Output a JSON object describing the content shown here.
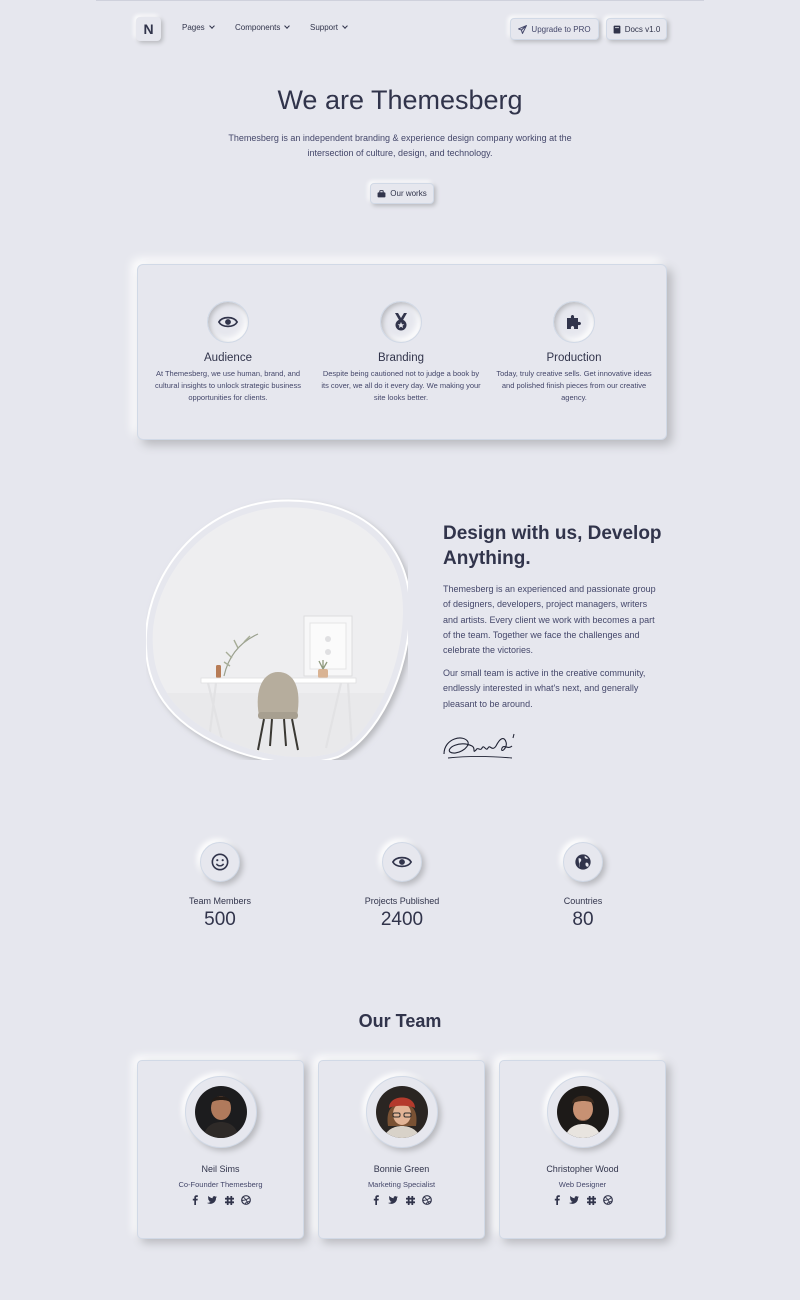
{
  "nav": {
    "brand": "N",
    "items": [
      {
        "label": "Pages"
      },
      {
        "label": "Components"
      },
      {
        "label": "Support"
      }
    ],
    "upgrade_label": "Upgrade to PRO",
    "docs_label": "Docs v1.0"
  },
  "hero": {
    "title": "We are Themesberg",
    "text": "Themesberg is an independent branding & experience design company working at the intersection of culture, design, and technology.",
    "button_label": "Our works"
  },
  "features": [
    {
      "icon": "eye-icon",
      "title": "Audience",
      "text": "At Themesberg, we use human, brand, and cultural insights to unlock strategic business opportunities for clients."
    },
    {
      "icon": "medal-icon",
      "title": "Branding",
      "text": "Despite being cautioned not to judge a book by its cover, we all do it every day. We making your site looks better."
    },
    {
      "icon": "puzzle-icon",
      "title": "Production",
      "text": "Today, truly creative sells. Get innovative ideas and polished finish pieces from our creative agency."
    }
  ],
  "about": {
    "title": "Design with us, Develop Anything.",
    "p1": "Themesberg is an experienced and passionate group of designers, developers, project managers, writers and artists. Every client we work with becomes a part of the team. Together we face the challenges and celebrate the victories.",
    "p2": "Our small team is active in the creative community, endlessly interested in what's next, and generally pleasant to be around."
  },
  "stats": [
    {
      "icon": "smile-icon",
      "label": "Team Members",
      "value": "500"
    },
    {
      "icon": "eye-icon",
      "label": "Projects Published",
      "value": "2400"
    },
    {
      "icon": "globe-icon",
      "label": "Countries",
      "value": "80"
    }
  ],
  "team": {
    "title": "Our Team",
    "members": [
      {
        "name": "Neil Sims",
        "role": "Co-Founder Themesberg"
      },
      {
        "name": "Bonnie Green",
        "role": "Marketing Specialist"
      },
      {
        "name": "Christopher Wood",
        "role": "Web Designer"
      }
    ]
  },
  "colors": {
    "background": "#e6e7ee",
    "text": "#31344b",
    "muted": "#44476a"
  }
}
